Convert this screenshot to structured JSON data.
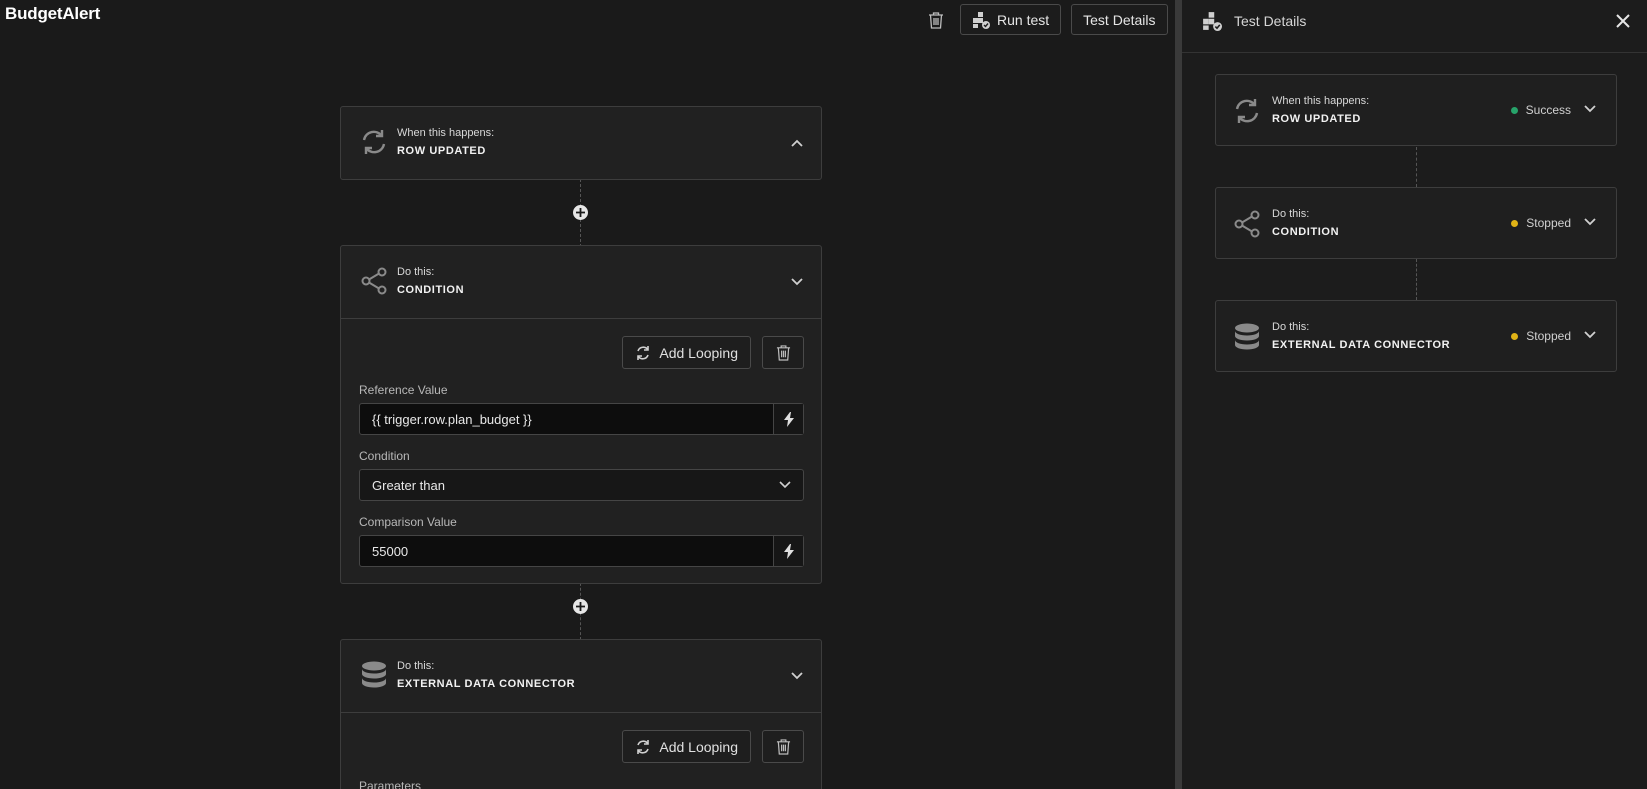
{
  "app": {
    "title": "BudgetAlert"
  },
  "toolbar": {
    "run_test_label": "Run test",
    "test_details_label": "Test Details"
  },
  "canvas": {
    "nodes": [
      {
        "subtitle": "When this happens:",
        "name": "ROW UPDATED",
        "icon": "refresh-icon",
        "expanded": false
      },
      {
        "subtitle": "Do this:",
        "name": "CONDITION",
        "icon": "share-icon",
        "expanded": true,
        "add_looping_label": "Add Looping",
        "reference_label": "Reference Value",
        "reference_value": "{{ trigger.row.plan_budget }}",
        "condition_label": "Condition",
        "condition_value": "Greater than",
        "comparison_label": "Comparison Value",
        "comparison_value": "55000"
      },
      {
        "subtitle": "Do this:",
        "name": "EXTERNAL DATA CONNECTOR",
        "icon": "database-icon",
        "expanded": true,
        "add_looping_label": "Add Looping",
        "parameters_label": "Parameters"
      }
    ]
  },
  "panel": {
    "title": "Test Details",
    "items": [
      {
        "subtitle": "When this happens:",
        "name": "ROW UPDATED",
        "status": "Success",
        "status_color": "#27a36a"
      },
      {
        "subtitle": "Do this:",
        "name": "CONDITION",
        "status": "Stopped",
        "status_color": "#e0b316"
      },
      {
        "subtitle": "Do this:",
        "name": "EXTERNAL DATA CONNECTOR",
        "status": "Stopped",
        "status_color": "#e0b316"
      }
    ]
  }
}
